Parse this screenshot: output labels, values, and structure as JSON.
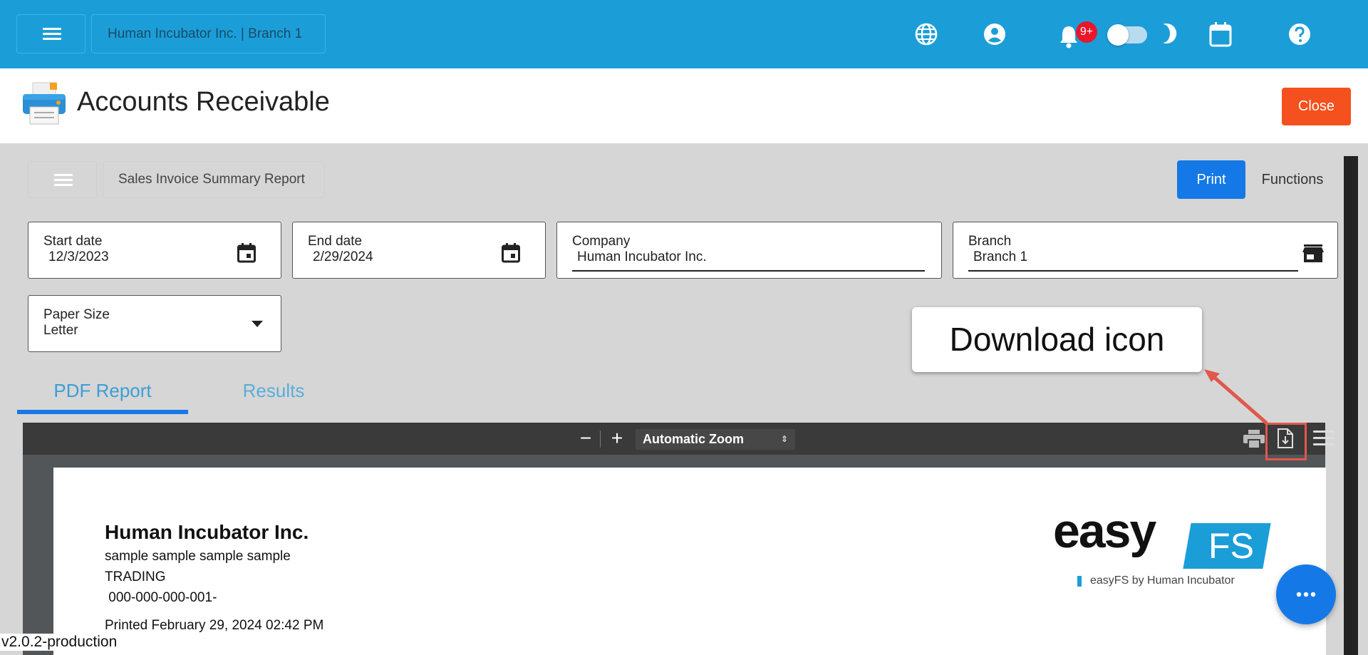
{
  "topbar": {
    "org_label": "Human Incubator Inc. | Branch 1",
    "notification_badge": "9+",
    "theme_toggle_on": false,
    "accent": "#1b9ed8"
  },
  "module": {
    "title": "Accounts Receivable",
    "close_label": "Close"
  },
  "toolbar": {
    "report_name": "Sales Invoice Summary Report",
    "print_label": "Print",
    "functions_label": "Functions"
  },
  "filters": {
    "start_date": {
      "label": "Start date",
      "value": "12/3/2023"
    },
    "end_date": {
      "label": "End date",
      "value": "2/29/2024"
    },
    "company": {
      "label": "Company",
      "value": "Human Incubator Inc."
    },
    "branch": {
      "label": "Branch",
      "value": "Branch 1"
    },
    "paper_size": {
      "label": "Paper Size",
      "value": "Letter"
    }
  },
  "tabs": [
    {
      "label": "PDF Report",
      "active": true
    },
    {
      "label": "Results",
      "active": false
    }
  ],
  "viewer": {
    "zoom": "Automatic Zoom"
  },
  "pdf": {
    "company": "Human Incubator Inc.",
    "line1": "sample sample sample sample",
    "line2": "TRADING",
    "line3": " 000-000-000-001-",
    "printed": "Printed February 29, 2024 02:42 PM",
    "logo_word": "easy",
    "logo_box": "FS",
    "logo_tagline": "easyFS by Human Incubator"
  },
  "annotation": {
    "callout": "Download icon"
  },
  "footer": {
    "version": "v2.0.2-production"
  }
}
